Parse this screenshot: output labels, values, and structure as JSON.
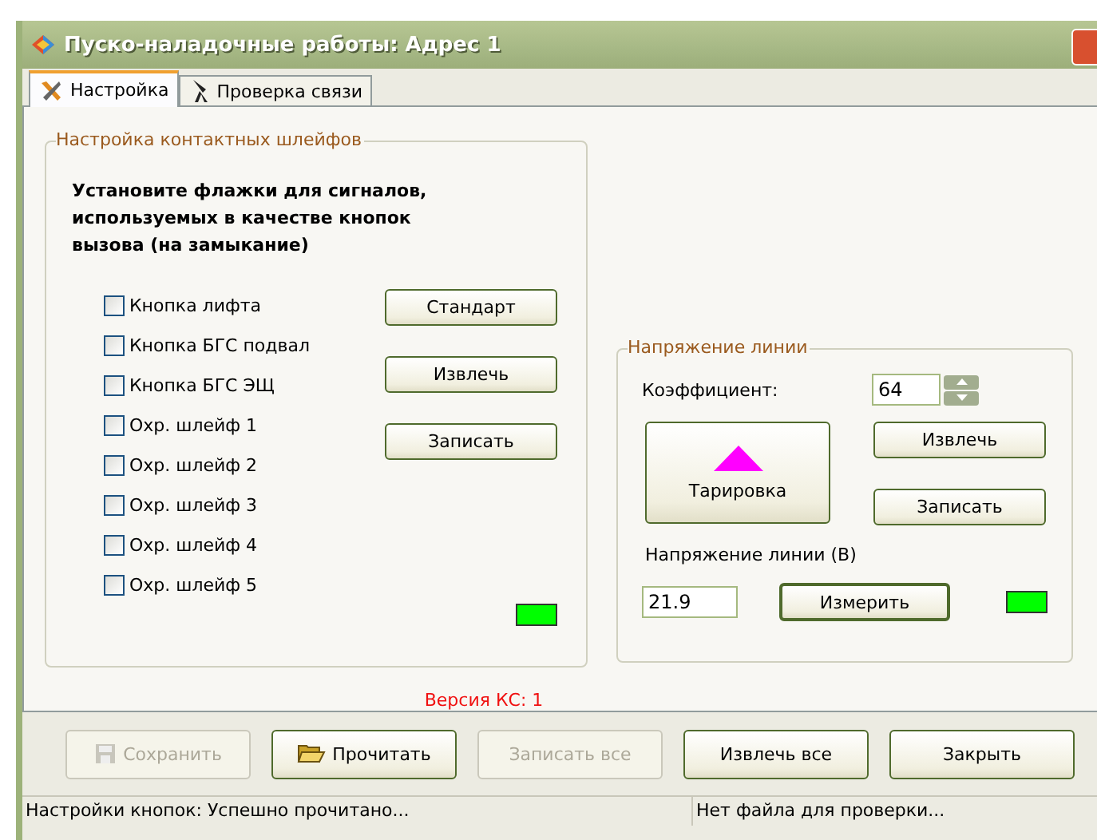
{
  "window": {
    "title": "Пуско-наладочные работы: Адрес 1"
  },
  "tabs": [
    {
      "label": "Настройка",
      "selected": true
    },
    {
      "label": "Проверка связи",
      "selected": false
    }
  ],
  "contacts_group": {
    "title": "Настройка  контактных шлейфов",
    "instruction": "Установите флажки для сигналов, используемых в качестве кнопок вызова (на замыкание)",
    "checkboxes": [
      {
        "label": "Кнопка лифта",
        "checked": false
      },
      {
        "label": "Кнопка БГС подвал",
        "checked": false
      },
      {
        "label": "Кнопка БГС ЭЩ",
        "checked": false
      },
      {
        "label": "Охр. шлейф 1",
        "checked": false
      },
      {
        "label": "Охр. шлейф 2",
        "checked": false
      },
      {
        "label": "Охр. шлейф 3",
        "checked": false
      },
      {
        "label": "Охр. шлейф 4",
        "checked": false
      },
      {
        "label": "Охр. шлейф 5",
        "checked": false
      }
    ],
    "buttons": [
      "Стандарт",
      "Извлечь",
      "Записать"
    ],
    "indicator": {
      "color": "#00ff00"
    }
  },
  "voltage_group": {
    "title": "Напряжение линии",
    "coefficient_label": "Коэффициент:",
    "coefficient": "64",
    "calibrate_button": "Тарировка",
    "buttons": [
      "Извлечь",
      "Записать"
    ],
    "voltage_label": "Напряжение линии (В)",
    "voltage": "21.9",
    "measure_button": "Измерить",
    "indicator": {
      "color": "#00ff00"
    }
  },
  "version": "Версия КС: 1",
  "footer_buttons": [
    {
      "label": "Сохранить",
      "disabled": true
    },
    {
      "label": "Прочитать",
      "disabled": false
    },
    {
      "label": "Записать все",
      "disabled": true
    },
    {
      "label": "Извлечь все",
      "disabled": false
    },
    {
      "label": "Закрыть",
      "disabled": false
    }
  ],
  "status_bar": [
    "Настройки кнопок: Успешно прочитано...",
    "Нет файла для проверки..."
  ]
}
